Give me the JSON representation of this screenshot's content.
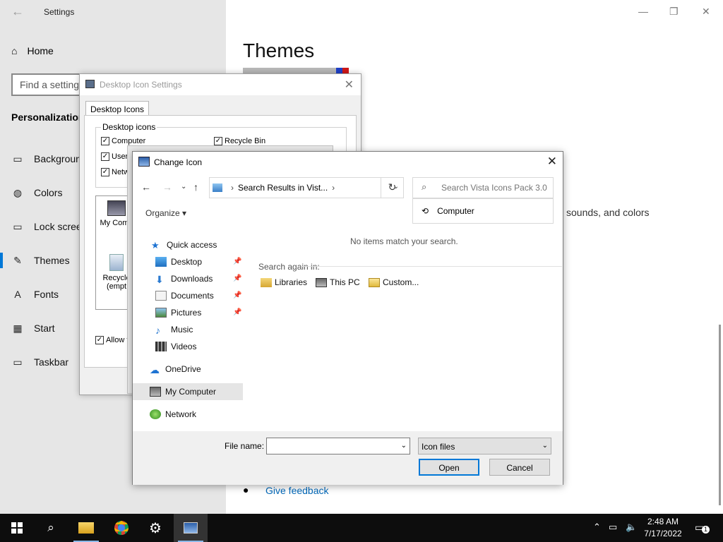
{
  "settings": {
    "title": "Settings",
    "home": "Home",
    "search_placeholder": "Find a setting",
    "section": "Personalization",
    "nav": [
      {
        "label": "Background",
        "icon": "image-icon"
      },
      {
        "label": "Colors",
        "icon": "palette-icon"
      },
      {
        "label": "Lock screen",
        "icon": "lock-screen-icon"
      },
      {
        "label": "Themes",
        "icon": "themes-icon"
      },
      {
        "label": "Fonts",
        "icon": "fonts-icon"
      },
      {
        "label": "Start",
        "icon": "start-icon"
      },
      {
        "label": "Taskbar",
        "icon": "taskbar-icon"
      }
    ],
    "main_title": "Themes",
    "sounds_text": "sounds, and colors",
    "feedback": "Give feedback",
    "accent": "#0078d7"
  },
  "desktop_icon_settings": {
    "title": "Desktop Icon Settings",
    "tab": "Desktop Icons",
    "group": "Desktop icons",
    "checkboxes": [
      "Computer",
      "User",
      "Netw",
      "Recycle Bin"
    ],
    "icons": [
      "My Comp",
      "Recycle",
      "(empt"
    ],
    "allow": "Allow t"
  },
  "change_icon": {
    "title": "Change Icon",
    "address": "Search Results in Vist...",
    "search_placeholder": "Search Vista Icons Pack 3.0",
    "suggestion": "Computer",
    "organize": "Organize",
    "tree": [
      {
        "label": "Quick access",
        "icon": "star-icon"
      },
      {
        "label": "Desktop",
        "icon": "desktop-folder-icon",
        "pinned": true
      },
      {
        "label": "Downloads",
        "icon": "downloads-icon",
        "pinned": true
      },
      {
        "label": "Documents",
        "icon": "documents-icon",
        "pinned": true
      },
      {
        "label": "Pictures",
        "icon": "pictures-icon",
        "pinned": true
      },
      {
        "label": "Music",
        "icon": "music-icon"
      },
      {
        "label": "Videos",
        "icon": "videos-icon"
      },
      {
        "label": "OneDrive",
        "icon": "cloud-icon"
      },
      {
        "label": "My Computer",
        "icon": "computer-icon"
      },
      {
        "label": "Network",
        "icon": "network-icon"
      }
    ],
    "no_items": "No items match your search.",
    "search_again": "Search again in:",
    "search_again_links": [
      "Libraries",
      "This PC",
      "Custom..."
    ],
    "file_name_label": "File name:",
    "file_name_value": "",
    "file_type": "Icon files",
    "open": "Open",
    "cancel": "Cancel"
  },
  "taskbar": {
    "time": "2:48 AM",
    "date": "7/17/2022",
    "notification_count": "1"
  }
}
